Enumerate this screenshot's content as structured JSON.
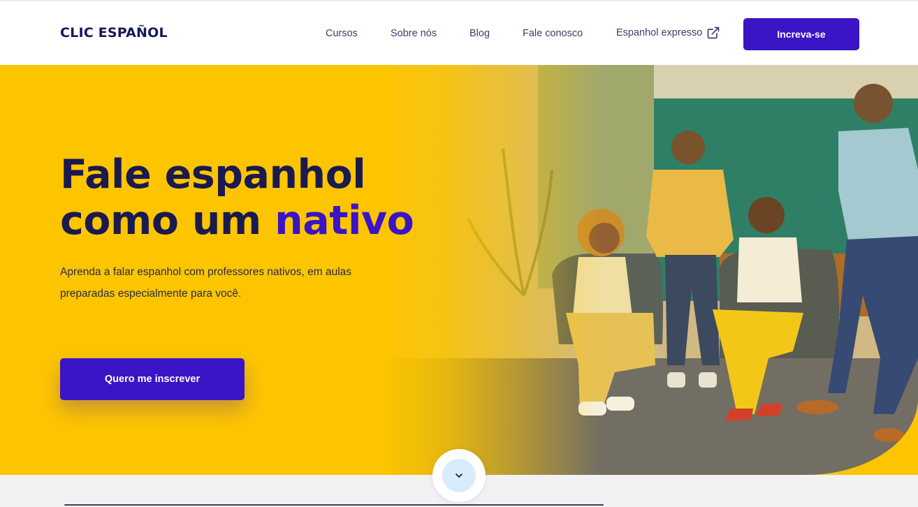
{
  "header": {
    "logo": "CLIC ESPAÑOL",
    "nav": {
      "cursos": "Cursos",
      "sobre": "Sobre nós",
      "blog": "Blog",
      "fale": "Fale conosco",
      "expresso": "Espanhol expresso"
    },
    "cta": "Increva-se"
  },
  "hero": {
    "title_line1": "Fale espanhol",
    "title_line2_prefix": "como um ",
    "title_line2_accent": "nativo",
    "subtitle": "Aprenda a falar espanhol com professores nativos, em aulas preparadas especialmente para você.",
    "cta": "Quero me inscrever"
  },
  "icons": {
    "external": "external-link-icon",
    "scroll": "chevron-down-icon"
  },
  "colors": {
    "brand_purple": "#3b14c6",
    "hero_yellow": "#fdc500",
    "navy": "#1b1a4e"
  }
}
